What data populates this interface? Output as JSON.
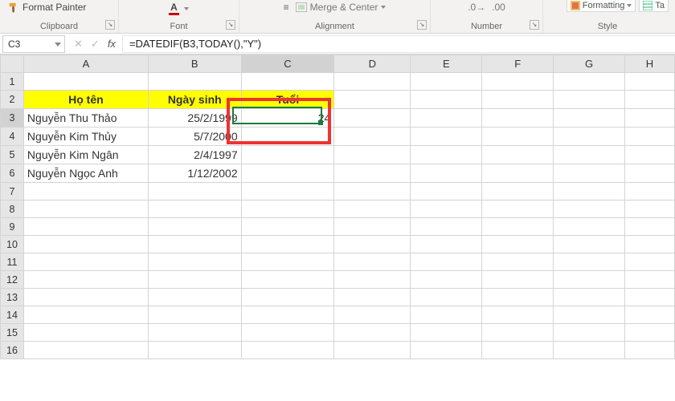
{
  "ribbon": {
    "format_painter": "Format Painter",
    "groups": {
      "clipboard": "Clipboard",
      "font": "Font",
      "alignment": "Alignment",
      "number": "Number",
      "style": "Style"
    },
    "merge_center": "Merge & Center",
    "conditional_formatting": "Formatting",
    "table_prefix": "Ta"
  },
  "namebox": {
    "value": "C3"
  },
  "formula_bar": {
    "text": "=DATEDIF(B3,TODAY(),\"Y\")"
  },
  "grid": {
    "columns": [
      "A",
      "B",
      "C",
      "D",
      "E",
      "F",
      "G",
      "H"
    ],
    "active_cell": "C3",
    "headers": {
      "A": "Họ tên",
      "B": "Ngày sinh",
      "C": "Tuổi"
    },
    "rows": [
      {
        "r": 3,
        "name": "Nguyễn Thu Thảo",
        "birth": "25/2/1999",
        "age": "24"
      },
      {
        "r": 4,
        "name": "Nguyễn Kim Thủy",
        "birth": "5/7/2000",
        "age": ""
      },
      {
        "r": 5,
        "name": "Nguyễn Kim Ngân",
        "birth": "2/4/1997",
        "age": ""
      },
      {
        "r": 6,
        "name": "Nguyễn Ngọc Anh",
        "birth": "1/12/2002",
        "age": ""
      }
    ],
    "blank_row_count_after": 10
  }
}
